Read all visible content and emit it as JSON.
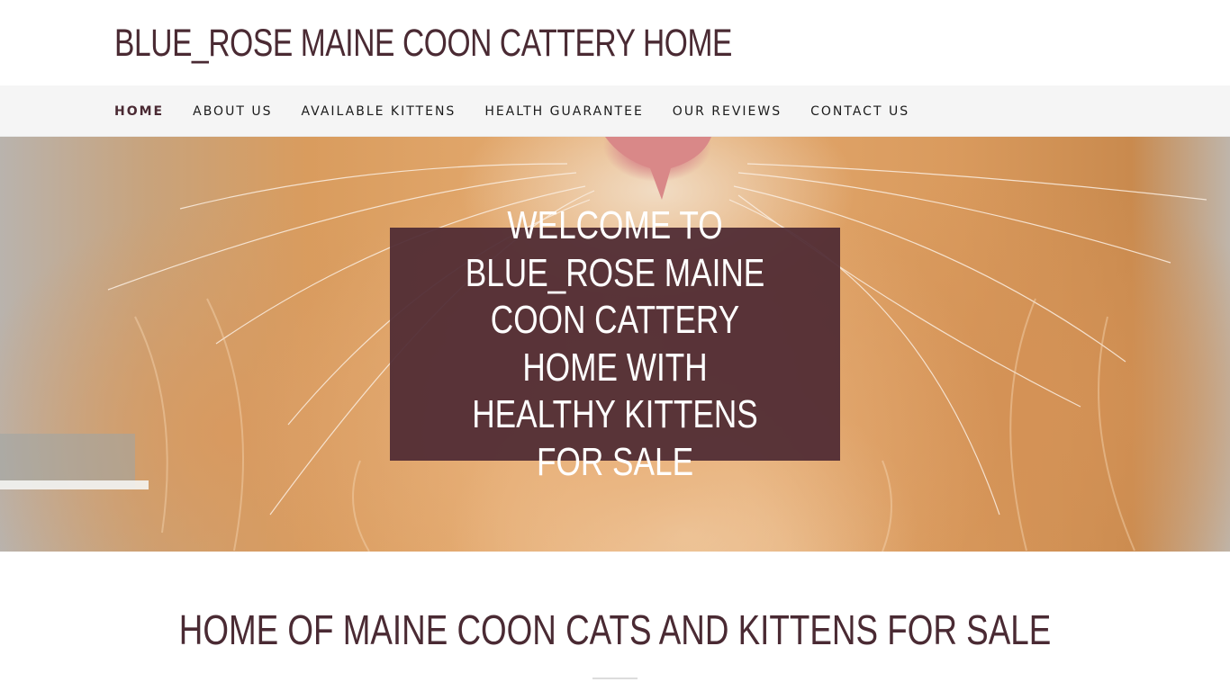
{
  "header": {
    "site_title": "BLUE_ROSE MAINE COON CATTERY HOME"
  },
  "nav": {
    "items": [
      {
        "label": "HOME",
        "active": true
      },
      {
        "label": "ABOUT US",
        "active": false
      },
      {
        "label": "AVAILABLE KITTENS",
        "active": false
      },
      {
        "label": "HEALTH GUARANTEE",
        "active": false
      },
      {
        "label": "OUR REVIEWS",
        "active": false
      },
      {
        "label": "CONTACT US",
        "active": false
      }
    ]
  },
  "hero": {
    "title": "WELCOME TO BLUE_ROSE MAINE COON CATTERY HOME WITH HEALTHY KITTENS FOR SALE"
  },
  "section": {
    "title": "HOME OF MAINE COON CATS AND KITTENS FOR SALE"
  },
  "colors": {
    "brand": "#4a2a33",
    "nav_background": "#f5f5f5",
    "hero_overlay": "#502c34"
  }
}
